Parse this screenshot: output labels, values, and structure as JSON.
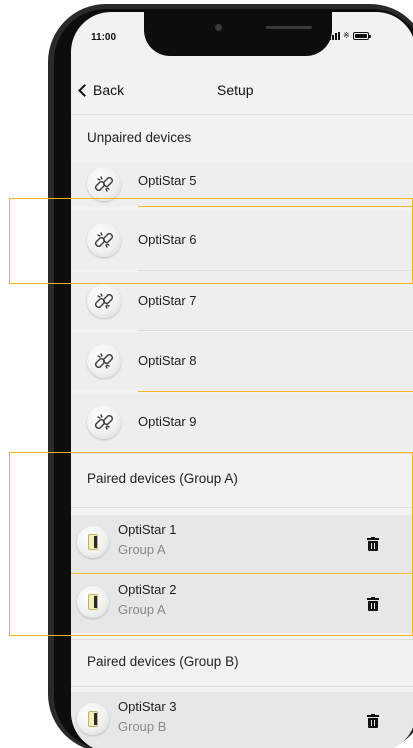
{
  "status_bar": {
    "time": "11:00"
  },
  "nav": {
    "back_label": "Back",
    "title": "Setup"
  },
  "sections": {
    "unpaired_title": "Unpaired devices",
    "paired_a_title": "Paired devices (Group A)",
    "paired_b_title": "Paired devices (Group B)"
  },
  "unpaired_devices": [
    {
      "name": "OptiStar 5",
      "icon": "unlink-icon"
    },
    {
      "name": "OptiStar 6",
      "icon": "unlink-icon"
    },
    {
      "name": "OptiStar 7",
      "icon": "unlink-icon"
    },
    {
      "name": "OptiStar 8",
      "icon": "unlink-icon"
    },
    {
      "name": "OptiStar 9",
      "icon": "unlink-icon"
    }
  ],
  "paired_group_a": [
    {
      "name": "OptiStar 1",
      "group": "Group A",
      "icon": "lamp-icon",
      "action_icon": "trash-icon"
    },
    {
      "name": "OptiStar 2",
      "group": "Group A",
      "icon": "lamp-icon",
      "action_icon": "trash-icon"
    }
  ],
  "paired_group_b": [
    {
      "name": "OptiStar 3",
      "group": "Group B",
      "icon": "lamp-icon",
      "action_icon": "trash-icon"
    }
  ],
  "colors": {
    "highlight": "#f5b524",
    "background": "#f2f2f2",
    "row_background": "#eeeeee",
    "paired_row_background": "#e7e7e7",
    "group_text": "#888888"
  }
}
